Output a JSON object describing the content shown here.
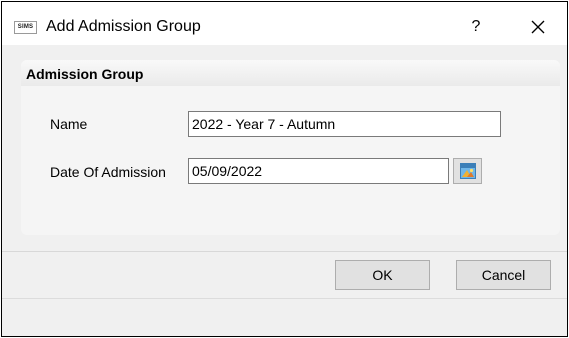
{
  "window": {
    "app_icon_text": "SIMS",
    "title": "Add Admission Group",
    "help_label": "?"
  },
  "group": {
    "title": "Admission Group",
    "name_label": "Name",
    "name_value": "2022 - Year 7 - Autumn",
    "date_label": "Date Of Admission",
    "date_value": "05/09/2022"
  },
  "footer": {
    "ok_label": "OK",
    "cancel_label": "Cancel"
  },
  "colors": {
    "window_border": "#000000",
    "dialog_background": "#f0f0f0",
    "button_background": "#e1e1e1",
    "input_border": "#7a7a7a"
  },
  "icons": {
    "close": "close-icon",
    "calendar": "calendar-icon",
    "app": "sims-app-icon"
  }
}
